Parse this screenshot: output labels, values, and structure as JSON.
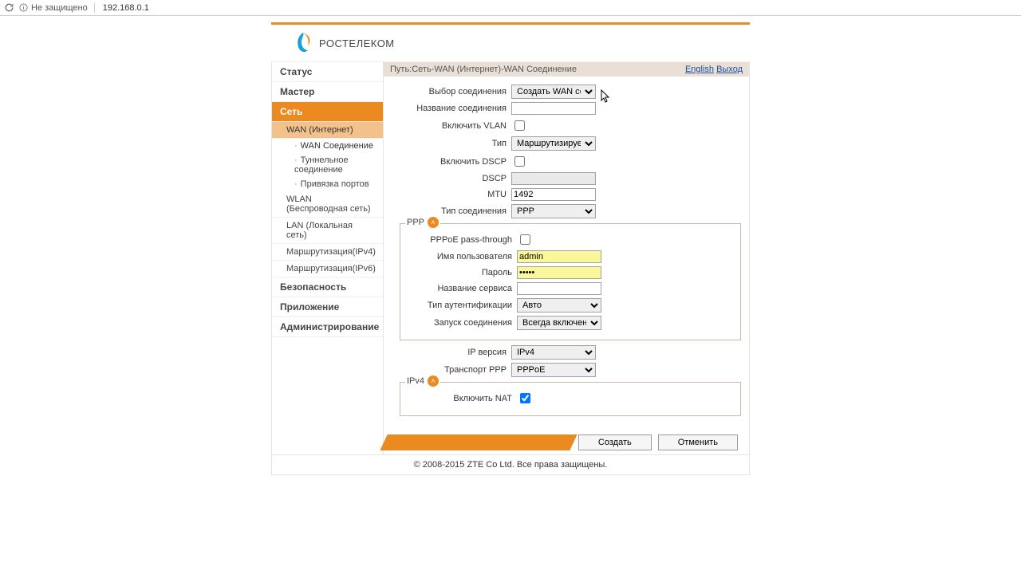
{
  "browser": {
    "insecure_label": "Не защищено",
    "url": "192.168.0.1"
  },
  "brand": "РОСТЕЛЕКОМ",
  "path_prefix": "Путь:",
  "breadcrumb": "Сеть-WAN (Интернет)-WAN Соединение",
  "lang_link": "English",
  "logout_link": "Выход",
  "sidebar": {
    "status": "Статус",
    "wizard": "Мастер",
    "network": "Сеть",
    "wan": "WAN (Интернет)",
    "wan_conn": "WAN Соединение",
    "tunnel": "Туннельное соединение",
    "port_bind": "Привязка портов",
    "wlan": "WLAN (Беспроводная сеть)",
    "lan": "LAN (Локальная сеть)",
    "routing4": "Маршрутизация(IPv4)",
    "routing6": "Маршрутизация(IPv6)",
    "security": "Безопасность",
    "application": "Приложение",
    "admin": "Администрирование"
  },
  "form": {
    "select_conn_label": "Выбор соединения",
    "select_conn_value": "Создать WAN соед",
    "conn_name_label": "Название соединения",
    "conn_name_value": "",
    "vlan_label": "Включить VLAN",
    "type_label": "Тип",
    "type_value": "Маршрутизируемо",
    "dscp_enable_label": "Включить DSCP",
    "dscp_label": "DSCP",
    "dscp_value": "",
    "mtu_label": "MTU",
    "mtu_value": "1492",
    "conn_type_label": "Тип соединения",
    "conn_type_value": "PPP"
  },
  "ppp": {
    "legend": "PPP",
    "passthrough_label": "PPPoE pass-through",
    "user_label": "Имя пользователя",
    "user_value": "admin",
    "pass_label": "Пароль",
    "pass_value": "•••••",
    "service_label": "Название сервиса",
    "service_value": "",
    "auth_label": "Тип аутентификации",
    "auth_value": "Авто",
    "dial_label": "Запуск соединения",
    "dial_value": "Всегда включено"
  },
  "post": {
    "ipver_label": "IP версия",
    "ipver_value": "IPv4",
    "transport_label": "Транспорт PPP",
    "transport_value": "PPPoE"
  },
  "ipv4": {
    "legend": "IPv4",
    "nat_label": "Включить NAT"
  },
  "buttons": {
    "create": "Создать",
    "cancel": "Отменить"
  },
  "footer": "© 2008-2015 ZTE Co Ltd. Все права защищены."
}
